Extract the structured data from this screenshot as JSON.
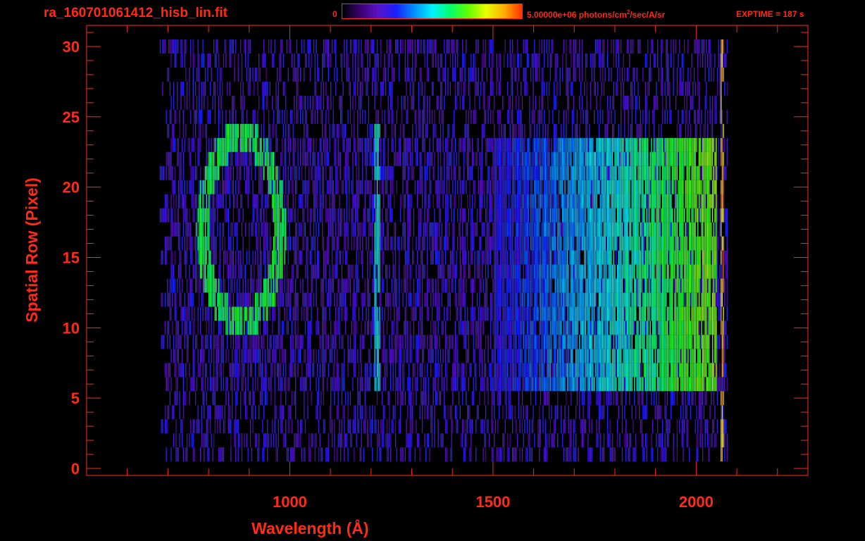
{
  "header": {
    "filename": "ra_160701061412_hisb_lin.fit",
    "colorbar_min_label": "0",
    "colorbar_max_value": "5.00000e+06",
    "colorbar_units_pre": "photons/cm",
    "colorbar_units_sup": "2",
    "colorbar_units_post": "/sec/A/sr",
    "exptime_label": "EXPTIME = 187 s"
  },
  "colors": {
    "axis": "#ff2a18",
    "background": "#000000",
    "colormap": [
      "#000000",
      "#3a0070",
      "#5a14c8",
      "#1a20ff",
      "#0090ff",
      "#00f0ff",
      "#00ff6a",
      "#60ff00",
      "#e8ff00",
      "#ffb000",
      "#ff3000"
    ]
  },
  "chart_data": {
    "type": "heatmap",
    "title": "",
    "xlabel": "Wavelength (Å)",
    "ylabel": "Spatial Row (Pixel)",
    "xlim": [
      500,
      2275
    ],
    "ylim": [
      -0.5,
      31.5
    ],
    "x_ticks": [
      1000,
      1500,
      2000
    ],
    "y_ticks": [
      0,
      5,
      10,
      15,
      20,
      25,
      30
    ],
    "colorbar": {
      "min": 0,
      "max": 5000000,
      "scale": "linear"
    },
    "detector": {
      "x_range": [
        680,
        2075
      ],
      "row_range": [
        1,
        30
      ],
      "signal_rows": [
        6,
        23
      ]
    },
    "features": [
      {
        "name": "ring",
        "center_x": 880,
        "center_y": 17,
        "radius_x": 95,
        "radius_y": 6.5,
        "level": 0.55
      },
      {
        "name": "line",
        "x": 1215,
        "y_range": [
          6,
          24
        ],
        "level": 0.45
      },
      {
        "name": "continuum",
        "x_range": [
          1500,
          2050
        ],
        "peak_level": 0.72
      }
    ]
  }
}
